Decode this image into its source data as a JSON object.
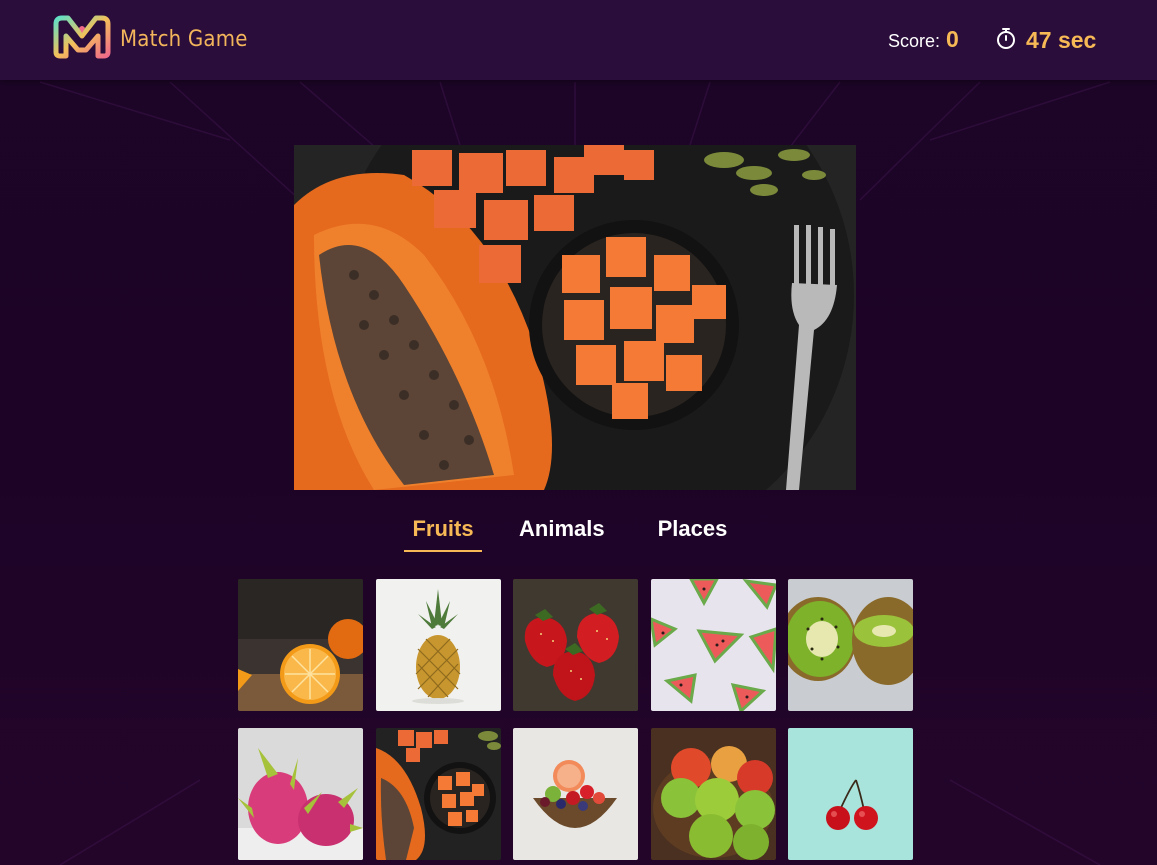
{
  "header": {
    "logo_text": "Match Game",
    "score_label": "Score:",
    "score_value": "0",
    "timer_value": "47 sec"
  },
  "colors": {
    "accent": "#f7b955",
    "header_bg": "#2a0d3a",
    "page_bg": "#1d0427"
  },
  "main_image": {
    "icon": "papaya-image"
  },
  "tabs": [
    {
      "label": "Fruits",
      "active": true
    },
    {
      "label": "Animals",
      "active": false
    },
    {
      "label": "Places",
      "active": false
    }
  ],
  "cards": [
    {
      "name": "orange-card"
    },
    {
      "name": "pineapple-card"
    },
    {
      "name": "strawberry-card"
    },
    {
      "name": "watermelon-card"
    },
    {
      "name": "kiwi-card"
    },
    {
      "name": "dragonfruit-card"
    },
    {
      "name": "papaya-card"
    },
    {
      "name": "fruit-bowl-card"
    },
    {
      "name": "apples-card"
    },
    {
      "name": "cherry-card"
    }
  ]
}
